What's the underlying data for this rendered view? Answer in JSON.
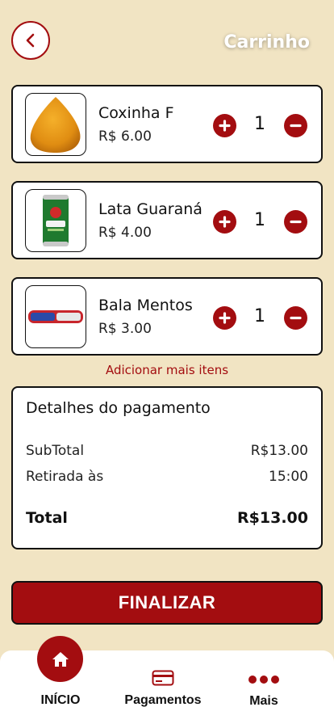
{
  "header": {
    "title": "Carrinho"
  },
  "cart": {
    "items": [
      {
        "name": "Coxinha F",
        "price": "R$ 6.00",
        "quantity": "1",
        "image": "coxinha"
      },
      {
        "name": "Lata Guaraná",
        "price": "R$ 4.00",
        "quantity": "1",
        "image": "guarana-can"
      },
      {
        "name": "Bala Mentos",
        "price": "R$ 3.00",
        "quantity": "1",
        "image": "mentos-roll"
      }
    ],
    "add_more_label": "Adicionar mais itens"
  },
  "payment": {
    "title": "Detalhes do pagamento",
    "subtotal_label": "SubTotal",
    "subtotal_value": "R$13.00",
    "pickup_label": "Retirada às",
    "pickup_value": "15:00",
    "total_label": "Total",
    "total_value": "R$13.00"
  },
  "actions": {
    "finalize_label": "FINALIZAR"
  },
  "nav": {
    "items": [
      {
        "label": "INÍCIO",
        "icon": "home-icon"
      },
      {
        "label": "Pagamentos",
        "icon": "credit-card-icon"
      },
      {
        "label": "Mais",
        "icon": "more-dots-icon"
      }
    ]
  },
  "colors": {
    "accent": "#a30d10",
    "background": "#f1e4c3",
    "card": "#ffffff"
  }
}
